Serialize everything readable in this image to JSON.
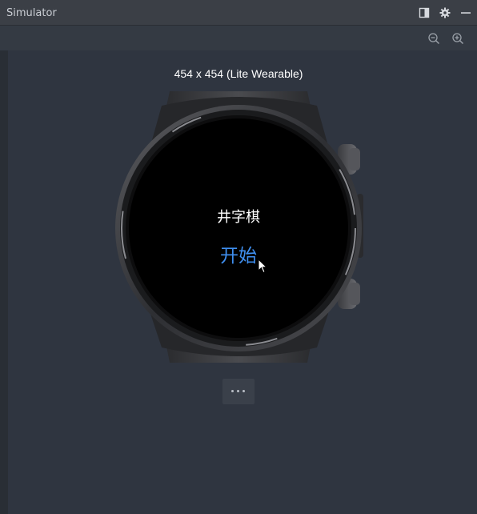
{
  "window": {
    "title": "Simulator",
    "icons": [
      "dock-panel-icon",
      "gear-icon",
      "minimize-icon"
    ]
  },
  "toolbar": {
    "icons": [
      "zoom-out-icon",
      "zoom-in-icon"
    ]
  },
  "device": {
    "label": "454 x 454 (Lite Wearable)"
  },
  "app": {
    "title": "井字棋",
    "start_label": "开始",
    "accent_color": "#3f8ff0",
    "screen_color": "#000000"
  },
  "more_button": {
    "icon": "more-dots-icon"
  }
}
